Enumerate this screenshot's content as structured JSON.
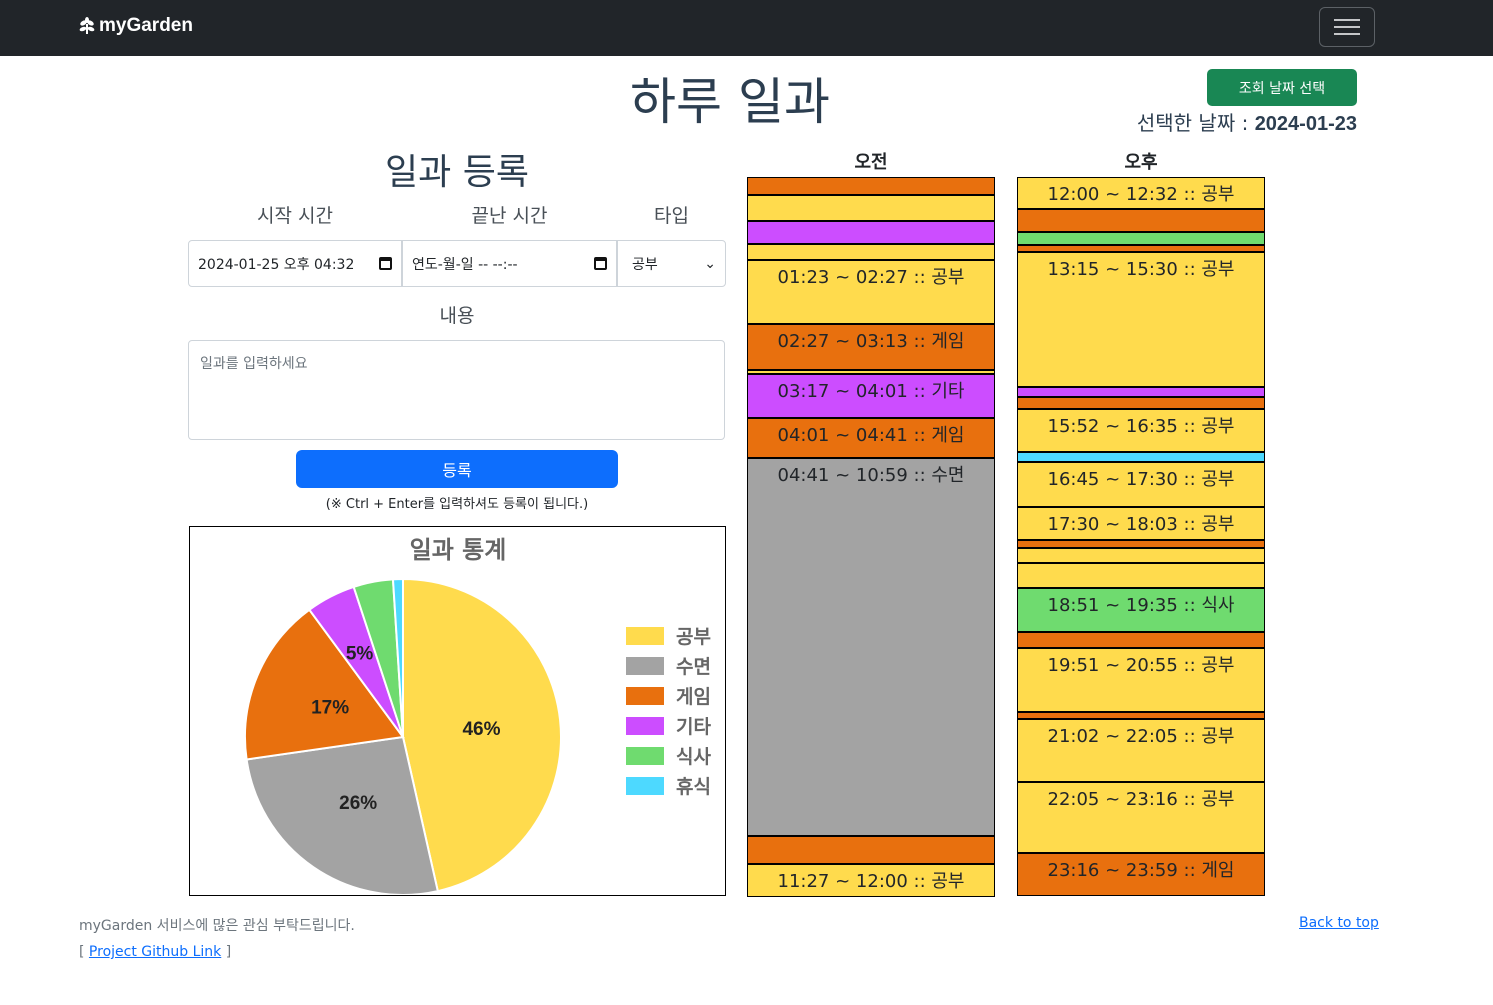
{
  "navbar": {
    "brand": "myGarden",
    "menu_icon": "hamburger-menu-icon"
  },
  "header": {
    "title": "하루 일과",
    "date_button": "조회 날짜 선택",
    "selected_label": "선택한 날짜 : ",
    "selected_date": "2024-01-23"
  },
  "form": {
    "title": "일과 등록",
    "start_label": "시작 시간",
    "end_label": "끝난 시간",
    "type_label": "타입",
    "start_value": "2024-01-25 오후 04:32",
    "end_value": "연도-월-일 -- --:--",
    "type_value": "공부",
    "content_label": "내용",
    "content_placeholder": "일과를 입력하세요",
    "submit_label": "등록",
    "hint": "(※ Ctrl + Enter를 입력하셔도 등록이 됩니다.)"
  },
  "colors": {
    "공부": "#ffdb4d",
    "수면": "#a3a3a3",
    "게임": "#e8700e",
    "기타": "#cc4dff",
    "식사": "#6fdb6f",
    "휴식": "#4dd9ff"
  },
  "chart_data": {
    "type": "pie",
    "title": "일과 통계",
    "categories": [
      "공부",
      "수면",
      "게임",
      "기타",
      "식사",
      "휴식"
    ],
    "values": [
      46,
      26,
      17,
      5,
      4,
      1
    ],
    "unit": "%",
    "shown_labels": [
      "46%",
      "26%",
      "17%",
      "5%",
      "",
      ""
    ],
    "legend_position": "right"
  },
  "schedule": {
    "am_label": "오전",
    "pm_label": "오후",
    "am": [
      {
        "start": 0.0,
        "end": 0.3,
        "type": "게임",
        "label": ""
      },
      {
        "start": 0.3,
        "end": 0.733,
        "type": "공부",
        "label": ""
      },
      {
        "start": 0.733,
        "end": 1.117,
        "type": "기타",
        "label": ""
      },
      {
        "start": 1.117,
        "end": 1.383,
        "type": "공부",
        "label": ""
      },
      {
        "start": 1.383,
        "end": 2.45,
        "type": "공부",
        "label": "01:23 ~ 02:27 :: 공부"
      },
      {
        "start": 2.45,
        "end": 3.217,
        "type": "게임",
        "label": "02:27 ~ 03:13 :: 게임"
      },
      {
        "start": 3.217,
        "end": 3.283,
        "type": "공부",
        "label": ""
      },
      {
        "start": 3.283,
        "end": 4.017,
        "type": "기타",
        "label": "03:17 ~ 04:01 :: 기타"
      },
      {
        "start": 4.017,
        "end": 4.683,
        "type": "게임",
        "label": "04:01 ~ 04:41 :: 게임"
      },
      {
        "start": 4.683,
        "end": 10.983,
        "type": "수면",
        "label": "04:41 ~ 10:59 :: 수면"
      },
      {
        "start": 10.983,
        "end": 11.45,
        "type": "게임",
        "label": ""
      },
      {
        "start": 11.45,
        "end": 12.0,
        "type": "공부",
        "label": "11:27 ~ 12:00 :: 공부"
      }
    ],
    "pm": [
      {
        "start": 0.0,
        "end": 0.533,
        "type": "공부",
        "label": "12:00 ~ 12:32 :: 공부"
      },
      {
        "start": 0.533,
        "end": 0.917,
        "type": "게임",
        "label": ""
      },
      {
        "start": 0.917,
        "end": 1.133,
        "type": "식사",
        "label": ""
      },
      {
        "start": 1.133,
        "end": 1.25,
        "type": "게임",
        "label": ""
      },
      {
        "start": 1.25,
        "end": 3.5,
        "type": "공부",
        "label": "13:15 ~ 15:30 :: 공부"
      },
      {
        "start": 3.5,
        "end": 3.667,
        "type": "기타",
        "label": ""
      },
      {
        "start": 3.667,
        "end": 3.867,
        "type": "게임",
        "label": ""
      },
      {
        "start": 3.867,
        "end": 4.583,
        "type": "공부",
        "label": "15:52 ~ 16:35 :: 공부"
      },
      {
        "start": 4.583,
        "end": 4.75,
        "type": "휴식",
        "label": ""
      },
      {
        "start": 4.75,
        "end": 5.5,
        "type": "공부",
        "label": "16:45 ~ 17:30 :: 공부"
      },
      {
        "start": 5.5,
        "end": 6.05,
        "type": "공부",
        "label": "17:30 ~ 18:03 :: 공부"
      },
      {
        "start": 6.05,
        "end": 6.183,
        "type": "게임",
        "label": ""
      },
      {
        "start": 6.183,
        "end": 6.433,
        "type": "공부",
        "label": ""
      },
      {
        "start": 6.433,
        "end": 6.85,
        "type": "공부",
        "label": ""
      },
      {
        "start": 6.85,
        "end": 7.583,
        "type": "식사",
        "label": "18:51 ~ 19:35 :: 식사"
      },
      {
        "start": 7.583,
        "end": 7.85,
        "type": "게임",
        "label": ""
      },
      {
        "start": 7.85,
        "end": 8.917,
        "type": "공부",
        "label": "19:51 ~ 20:55 :: 공부"
      },
      {
        "start": 8.917,
        "end": 9.033,
        "type": "게임",
        "label": ""
      },
      {
        "start": 9.033,
        "end": 10.083,
        "type": "공부",
        "label": "21:02 ~ 22:05 :: 공부"
      },
      {
        "start": 10.083,
        "end": 11.267,
        "type": "공부",
        "label": "22:05 ~ 23:16 :: 공부"
      },
      {
        "start": 11.267,
        "end": 11.983,
        "type": "게임",
        "label": "23:16 ~ 23:59 :: 게임"
      }
    ]
  },
  "footer": {
    "line1": "myGarden 서비스에 많은 관심 부탁드립니다.",
    "open_bracket": "[ ",
    "github_link": "Project Github Link",
    "close_bracket": " ]",
    "back_to_top": "Back to top"
  }
}
